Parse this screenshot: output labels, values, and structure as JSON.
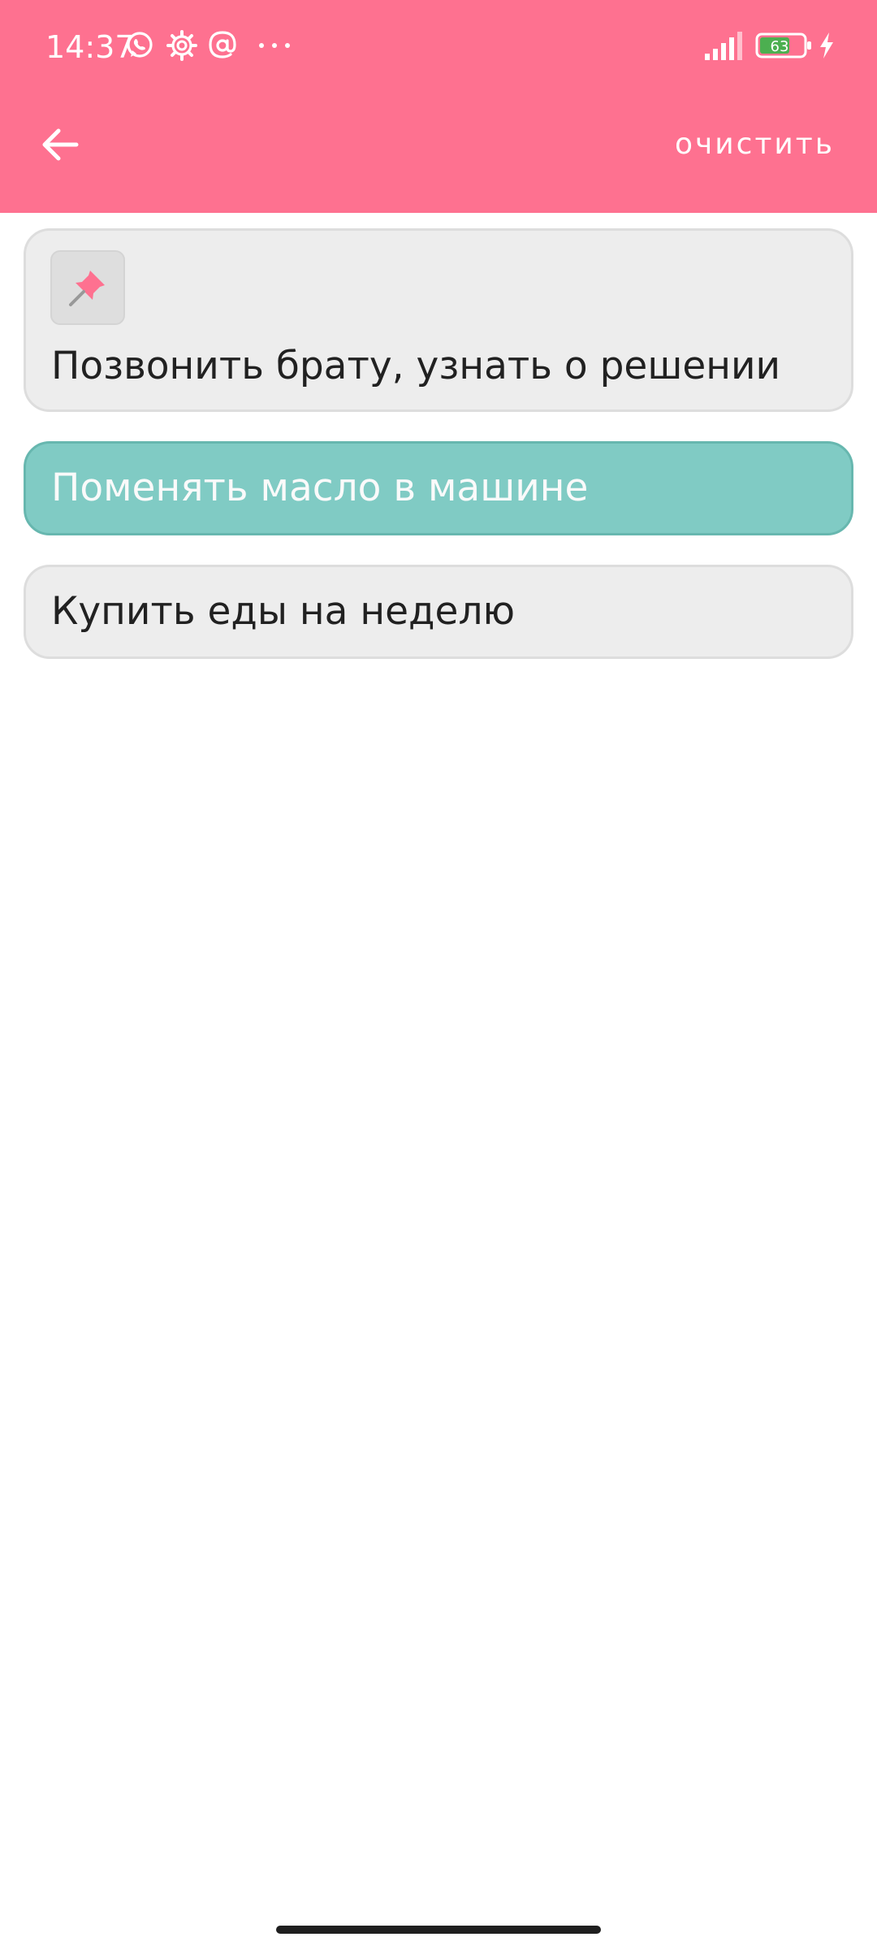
{
  "colors": {
    "header_bg": "#FE7190",
    "card_bg": "#EDEDED",
    "card_done_bg": "#80CBC4",
    "pin_accent": "#FE7190"
  },
  "status_bar": {
    "time": "14:37",
    "battery": "63",
    "icons": [
      "whatsapp-icon",
      "settings-gear-icon",
      "at-sign-icon",
      "more-dots-icon",
      "signal-icon",
      "battery-icon",
      "charging-bolt-icon"
    ]
  },
  "app_bar": {
    "back_icon": "arrow-left-icon",
    "clear_label": "ОЧИСТИТЬ"
  },
  "tasks": [
    {
      "text": "Позвонить брату, узнать о решении",
      "pinned": true,
      "done": false
    },
    {
      "text": "Поменять масло в машине",
      "pinned": false,
      "done": true
    },
    {
      "text": "Купить еды на неделю",
      "pinned": false,
      "done": false
    }
  ]
}
